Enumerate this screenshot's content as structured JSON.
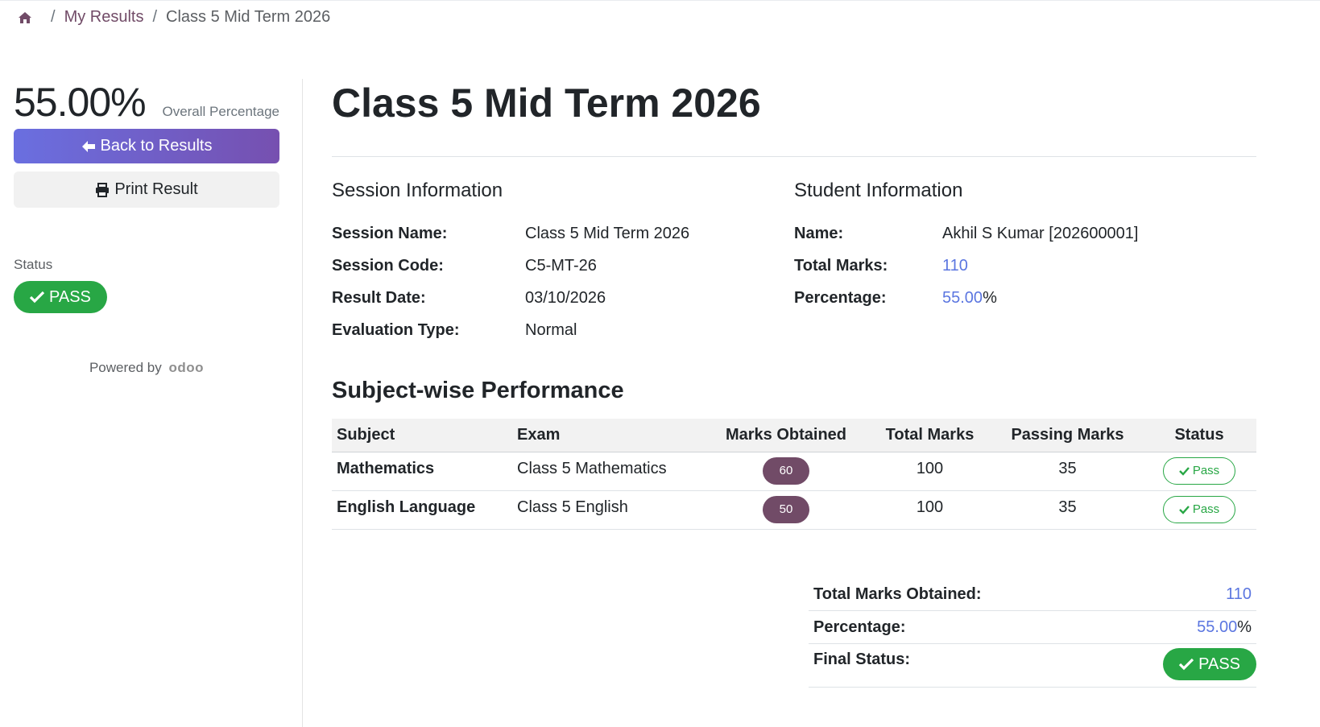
{
  "breadcrumb": {
    "home_icon": "home-icon",
    "items": [
      "My Results",
      "Class 5 Mid Term 2026"
    ]
  },
  "sidebar": {
    "overall_percentage": "55.00%",
    "overall_label": "Overall Percentage",
    "back_label": "Back to Results",
    "print_label": "Print Result",
    "status_label": "Status",
    "status_value": "PASS",
    "powered_by": "Powered by",
    "powered_logo": "odoo"
  },
  "main": {
    "title": "Class 5 Mid Term 2026",
    "session_info": {
      "heading": "Session Information",
      "rows": [
        {
          "label": "Session Name:",
          "value": "Class 5 Mid Term 2026"
        },
        {
          "label": "Session Code:",
          "value": "C5-MT-26"
        },
        {
          "label": "Result Date:",
          "value": "03/10/2026"
        },
        {
          "label": "Evaluation Type:",
          "value": "Normal"
        }
      ]
    },
    "student_info": {
      "heading": "Student Information",
      "name_label": "Name:",
      "name_value": "Akhil S Kumar [202600001]",
      "total_label": "Total Marks:",
      "total_value": "110",
      "pct_label": "Percentage:",
      "pct_value": "55.00",
      "pct_unit": "%"
    },
    "subjects": {
      "heading": "Subject-wise Performance",
      "columns": [
        "Subject",
        "Exam",
        "Marks Obtained",
        "Total Marks",
        "Passing Marks",
        "Status"
      ],
      "rows": [
        {
          "subject": "Mathematics",
          "exam": "Class 5 Mathematics",
          "obtained": "60",
          "total": "100",
          "passing": "35",
          "status": "Pass"
        },
        {
          "subject": "English Language",
          "exam": "Class 5 English",
          "obtained": "50",
          "total": "100",
          "passing": "35",
          "status": "Pass"
        }
      ]
    },
    "summary": {
      "total_label": "Total Marks Obtained:",
      "total_value": "110",
      "pct_label": "Percentage:",
      "pct_value": "55.00",
      "pct_unit": "%",
      "final_label": "Final Status:",
      "final_value": "PASS"
    }
  },
  "colors": {
    "brand": "#714B67",
    "accent_blue": "#5b76e0",
    "success": "#28a745",
    "gradient_start": "#6a6fe0",
    "gradient_end": "#7650b0"
  }
}
